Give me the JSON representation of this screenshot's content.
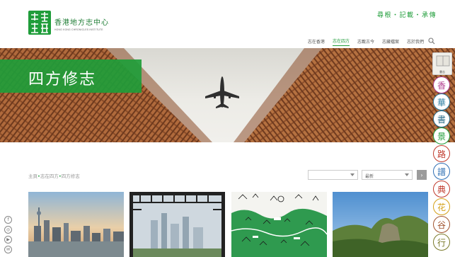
{
  "header": {
    "logo_title": "香港地方志中心",
    "logo_subtitle": "HONG KONG CHRONICLES INSTITUTE",
    "slogan": "尋根・記載・承傳"
  },
  "nav": {
    "items": [
      {
        "label": "志在香港",
        "active": false
      },
      {
        "label": "志在四方",
        "active": true
      },
      {
        "label": "志載古今",
        "active": false
      },
      {
        "label": "志藏檔案",
        "active": false
      },
      {
        "label": "志於我們",
        "active": false
      }
    ],
    "search_icon": "search-icon"
  },
  "hero": {
    "banner_title": "四方修志"
  },
  "breadcrumb": {
    "items": [
      "主頁",
      "志在四方",
      "四方修志"
    ],
    "separator": "•"
  },
  "filters": {
    "select1_value": "",
    "select2_value": "最新",
    "go_icon": "chevron-right-icon"
  },
  "side_nav": {
    "top_label": "書志",
    "badges": [
      {
        "glyph": "香",
        "color": "#b03a8c"
      },
      {
        "glyph": "華",
        "color": "#2b7ea1"
      },
      {
        "glyph": "書",
        "color": "#2b6d8a"
      },
      {
        "glyph": "景",
        "color": "#1f9d3a"
      },
      {
        "glyph": "路",
        "color": "#c0392b"
      },
      {
        "glyph": "譜",
        "color": "#2f6fb3"
      },
      {
        "glyph": "典",
        "color": "#c0392b"
      },
      {
        "glyph": "花",
        "color": "#d4a017"
      },
      {
        "glyph": "谷",
        "color": "#a0522d"
      },
      {
        "glyph": "行",
        "color": "#7a7a2a"
      }
    ]
  },
  "social": [
    "facebook-icon",
    "instagram-icon",
    "youtube-icon",
    "wechat-icon"
  ],
  "colors": {
    "brand_green": "#1f9d3a",
    "building_brown": "#b06a3c"
  }
}
